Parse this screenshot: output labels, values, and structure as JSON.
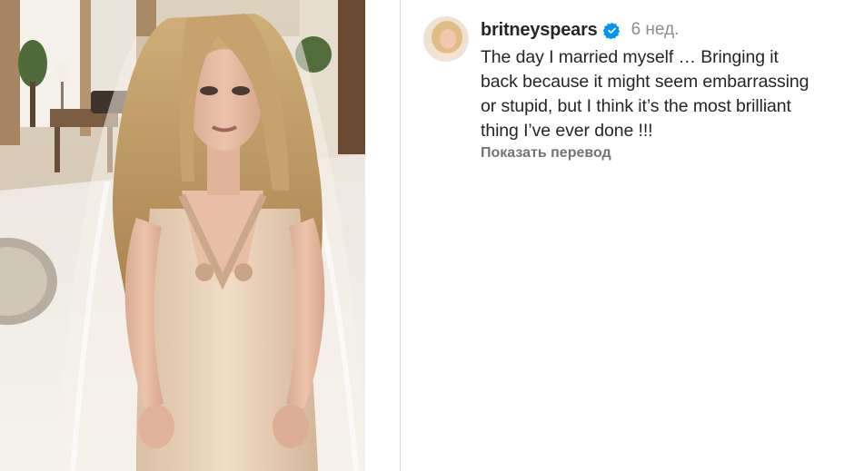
{
  "post": {
    "username": "britneyspears",
    "time": "6 нед.",
    "caption_lines": [
      "The day I married myself … Bringing it",
      "back because it might seem embarrassing",
      "or stupid, but I think it’s the most brilliant",
      "thing I’ve ever done !!!"
    ],
    "translate_label": "Показать перевод"
  },
  "icons": {
    "verified": "verified-badge-icon",
    "verified_color": "#0095f6"
  },
  "colors": {
    "username": "#262626",
    "meta": "#8e8e8e",
    "translate": "#737373",
    "divider": "#dbdbdb"
  }
}
